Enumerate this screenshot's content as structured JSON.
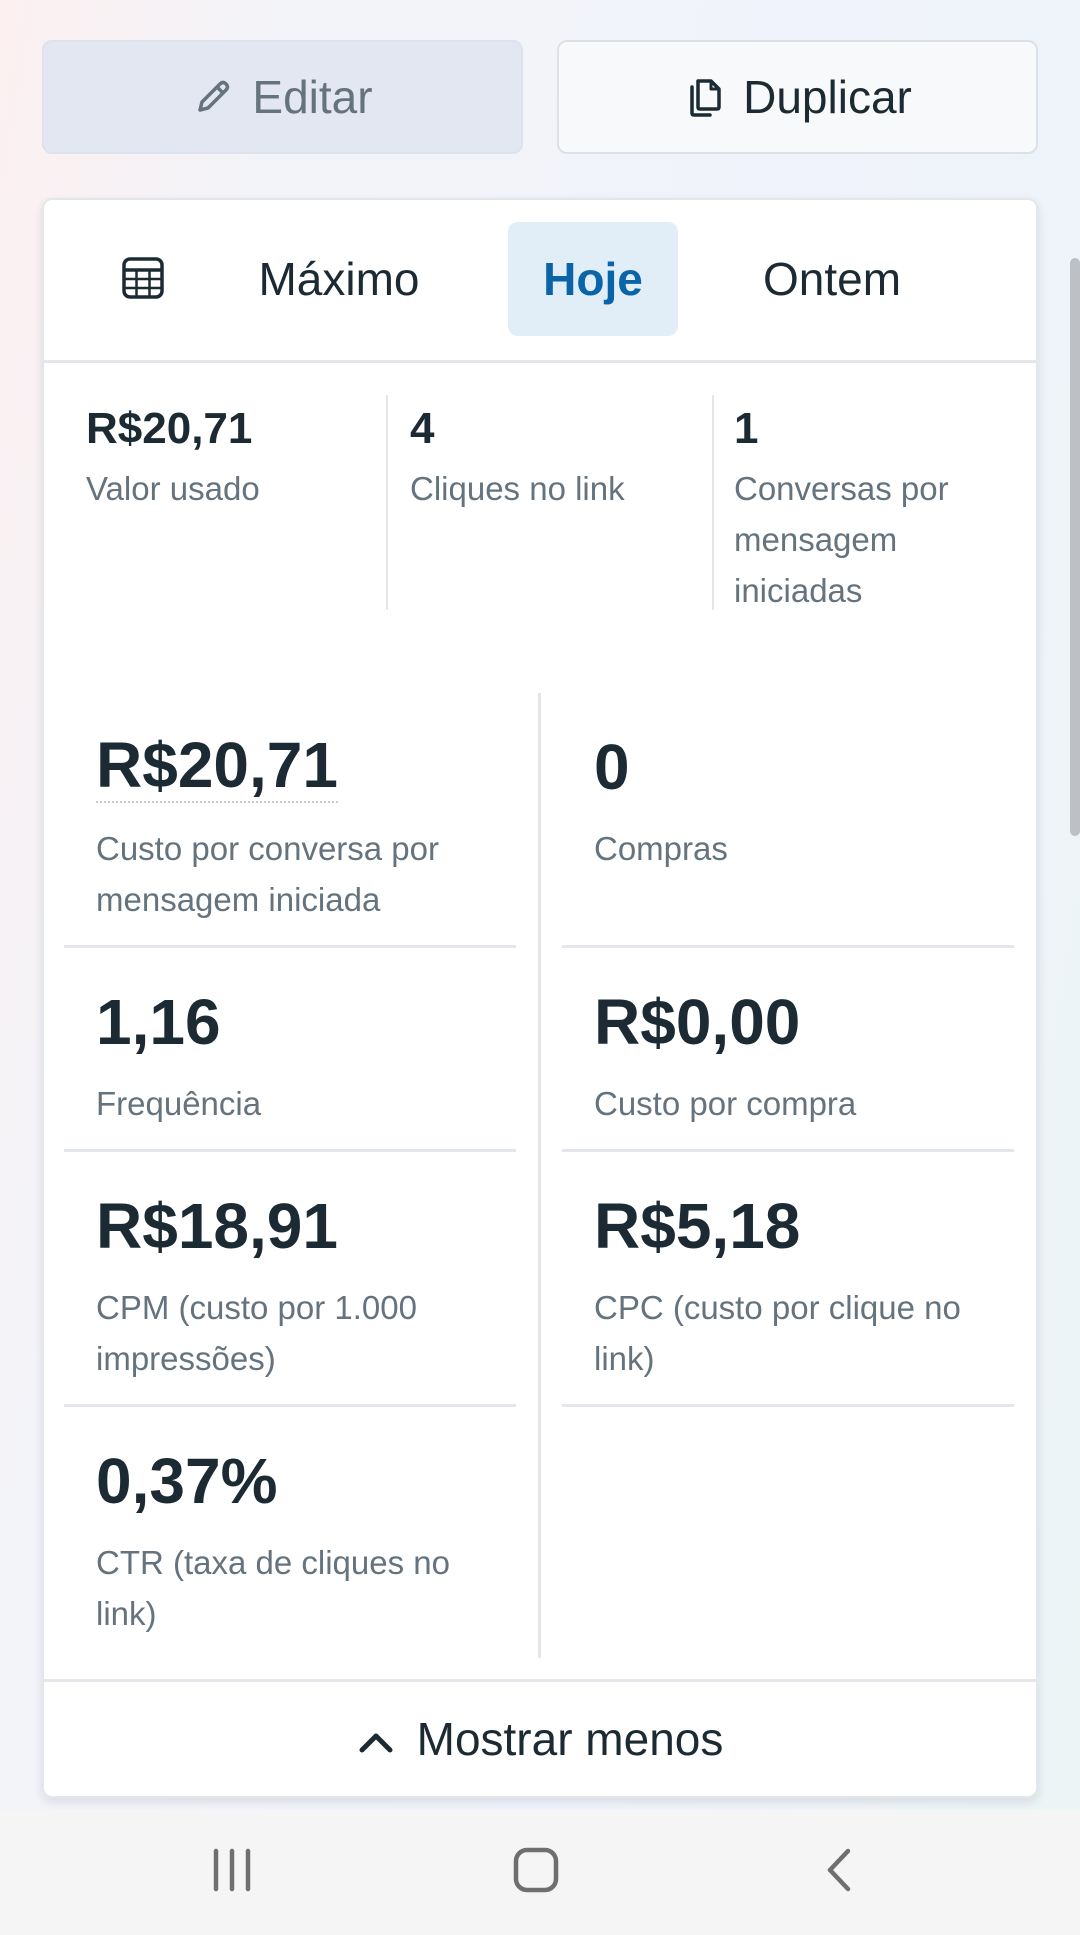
{
  "actions": {
    "edit_label": "Editar",
    "duplicate_label": "Duplicar"
  },
  "tabs": {
    "items": [
      {
        "label": "Máximo",
        "selected": false
      },
      {
        "label": "Hoje",
        "selected": true
      },
      {
        "label": "Ontem",
        "selected": false
      }
    ]
  },
  "summary": [
    {
      "value": "R$20,71",
      "label": "Valor usado"
    },
    {
      "value": "4",
      "label": "Cliques no link"
    },
    {
      "value": "1",
      "label": "Conversas por mensagem iniciadas"
    }
  ],
  "metrics": {
    "left": [
      {
        "value": "R$20,71",
        "label": "Custo por conversa por mensagem iniciada"
      },
      {
        "value": "1,16",
        "label": "Frequência"
      },
      {
        "value": "R$18,91",
        "label": "CPM (custo por 1.000 impressões)"
      },
      {
        "value": "0,37%",
        "label": "CTR (taxa de cliques no link)"
      }
    ],
    "right": [
      {
        "value": "0",
        "label": "Compras"
      },
      {
        "value": "R$0,00",
        "label": "Custo por compra"
      },
      {
        "value": "R$5,18",
        "label": "CPC (custo por clique no link)"
      }
    ]
  },
  "footer": {
    "toggle_label": "Mostrar menos"
  },
  "colors": {
    "accent": "#0a64a8",
    "selected_tab_bg": "#e1edf7",
    "text_primary": "#1c2b33",
    "text_secondary": "#65737e"
  },
  "icons": {
    "edit": "pencil-icon",
    "duplicate": "copy-icon",
    "table": "table-icon",
    "footer": "chevron-up-icon",
    "nav": [
      "recent-apps-icon",
      "home-icon",
      "back-icon"
    ]
  }
}
